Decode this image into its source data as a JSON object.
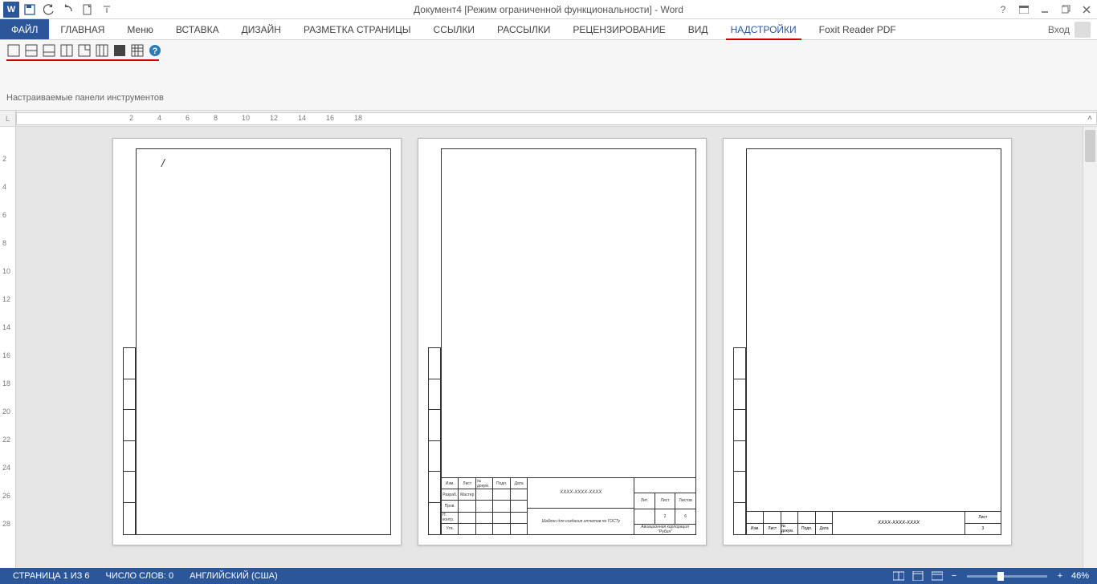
{
  "title": "Документ4 [Режим ограниченной функциональности] - Word",
  "qat": {
    "word": "W"
  },
  "tabs": {
    "file": "ФАЙЛ",
    "items": [
      "ГЛАВНАЯ",
      "Меню",
      "ВСТАВКА",
      "ДИЗАЙН",
      "РАЗМЕТКА СТРАНИЦЫ",
      "ССЫЛКИ",
      "РАССЫЛКИ",
      "РЕЦЕНЗИРОВАНИЕ",
      "ВИД",
      "НАДСТРОЙКИ",
      "Foxit Reader PDF"
    ],
    "active_index": 9
  },
  "signin": "Вход",
  "addin_group_label": "Настраиваемые панели инструментов",
  "hruler_numbers": [
    "2",
    "4",
    "6",
    "8",
    "10",
    "12",
    "14",
    "16",
    "18"
  ],
  "vruler_numbers": [
    "2",
    "4",
    "6",
    "8",
    "10",
    "12",
    "14",
    "16",
    "18",
    "20",
    "22",
    "24",
    "26",
    "28"
  ],
  "ruler_corner": "L",
  "doc": {
    "cursor_char": "/",
    "code": "XXXX-XXXX-XXXX",
    "tb_headers": [
      "Изм.",
      "Лист",
      "№ докум.",
      "Подп.",
      "Дата"
    ],
    "tb_rows_labels": [
      "Разраб.",
      "Провер.",
      "Пров.",
      "Н. контр.",
      "Утв."
    ],
    "tb_rows_r1_extra": "Мастер",
    "tb_mid_top": "Шаблон для создания отчетов по ГОСТу",
    "tb_company": "Авиационная корпорация \"Рубин\"",
    "tb_right_labels": [
      "Лит.",
      "Лист",
      "Листов"
    ],
    "tb_right_values": [
      "",
      "2",
      "6"
    ],
    "small_right_label": "Лист",
    "small_right_value": "3"
  },
  "status": {
    "page": "СТРАНИЦА 1 ИЗ 6",
    "words": "ЧИСЛО СЛОВ: 0",
    "lang": "АНГЛИЙСКИЙ (США)",
    "zoom": "46%",
    "minus": "−",
    "plus": "+"
  }
}
